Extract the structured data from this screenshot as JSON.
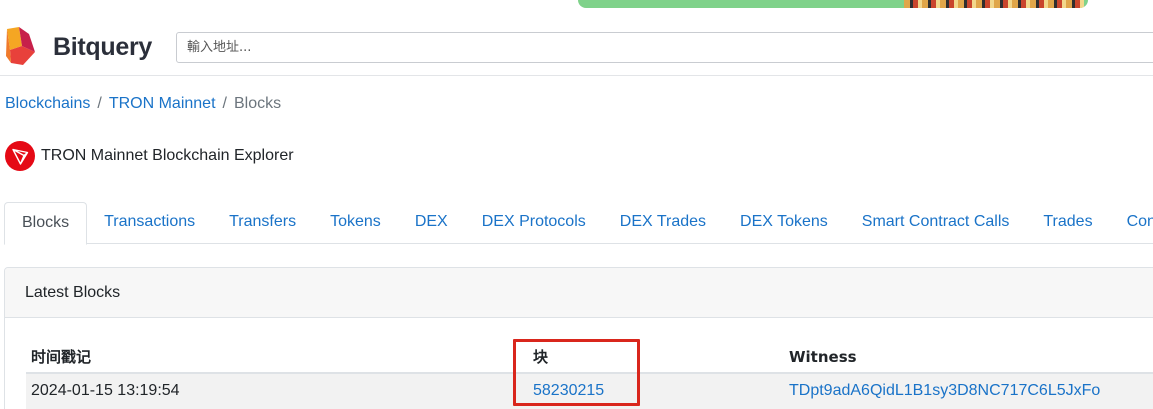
{
  "header": {
    "brand": "Bitquery",
    "search_placeholder": "輸入地址..."
  },
  "breadcrumb": {
    "items": [
      "Blockchains",
      "TRON Mainnet"
    ],
    "separator": "/",
    "current": "Blocks"
  },
  "explorer": {
    "title": "TRON Mainnet Blockchain Explorer"
  },
  "tabs": [
    {
      "label": "Blocks",
      "active": true
    },
    {
      "label": "Transactions"
    },
    {
      "label": "Transfers"
    },
    {
      "label": "Tokens"
    },
    {
      "label": "DEX"
    },
    {
      "label": "DEX Protocols"
    },
    {
      "label": "DEX Trades"
    },
    {
      "label": "DEX Tokens"
    },
    {
      "label": "Smart Contract Calls"
    },
    {
      "label": "Trades"
    },
    {
      "label": "Contr"
    }
  ],
  "card": {
    "title": "Latest Blocks",
    "columns": [
      "时间戳记",
      "块",
      "Witness"
    ],
    "rows": [
      {
        "timestamp": "2024-01-15 13:19:54",
        "block": "58230215",
        "witness": "TDpt9adA6QidL1B1sy3D8NC717C6L5JxFo"
      }
    ]
  },
  "colors": {
    "link": "#1a73c8",
    "highlight": "#d9261c",
    "tron_red": "#e50915"
  },
  "icons": [
    "bitquery-logo-icon",
    "tron-logo-icon"
  ]
}
